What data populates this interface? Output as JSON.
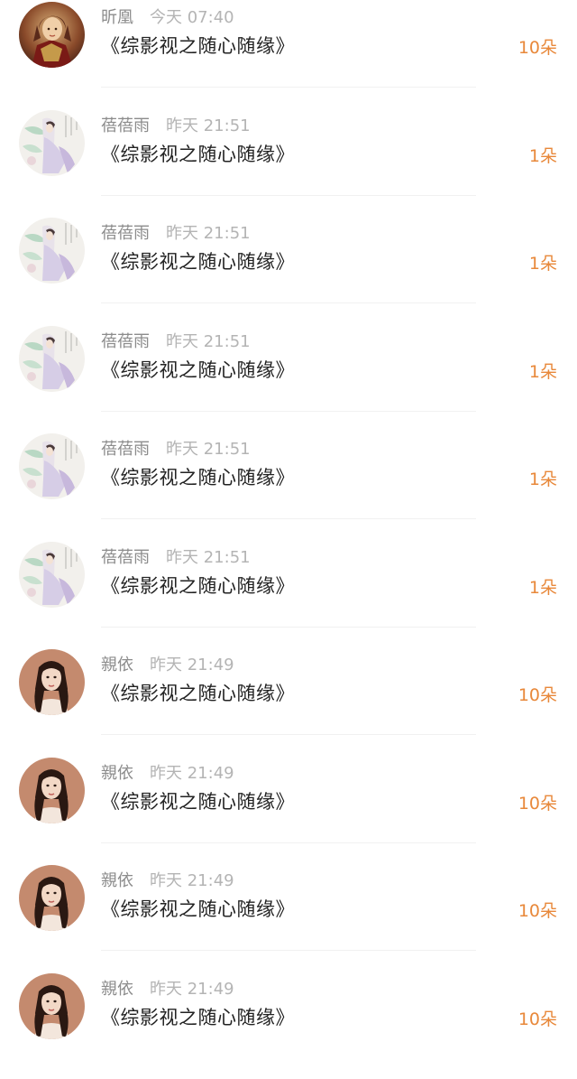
{
  "gifts": [
    {
      "name": "昕凰",
      "time": "今天 07:40",
      "book": "《综影视之随心随缘》",
      "amount": "10朵",
      "avatar": "warrior-avatar"
    },
    {
      "name": "蓓蓓雨",
      "time": "昨天 21:51",
      "book": "《综影视之随心随缘》",
      "amount": "1朵",
      "avatar": "painting-avatar"
    },
    {
      "name": "蓓蓓雨",
      "time": "昨天 21:51",
      "book": "《综影视之随心随缘》",
      "amount": "1朵",
      "avatar": "painting-avatar"
    },
    {
      "name": "蓓蓓雨",
      "time": "昨天 21:51",
      "book": "《综影视之随心随缘》",
      "amount": "1朵",
      "avatar": "painting-avatar"
    },
    {
      "name": "蓓蓓雨",
      "time": "昨天 21:51",
      "book": "《综影视之随心随缘》",
      "amount": "1朵",
      "avatar": "painting-avatar"
    },
    {
      "name": "蓓蓓雨",
      "time": "昨天 21:51",
      "book": "《综影视之随心随缘》",
      "amount": "1朵",
      "avatar": "painting-avatar"
    },
    {
      "name": "親依",
      "time": "昨天 21:49",
      "book": "《综影视之随心随缘》",
      "amount": "10朵",
      "avatar": "portrait-avatar"
    },
    {
      "name": "親依",
      "time": "昨天 21:49",
      "book": "《综影视之随心随缘》",
      "amount": "10朵",
      "avatar": "portrait-avatar"
    },
    {
      "name": "親依",
      "time": "昨天 21:49",
      "book": "《综影视之随心随缘》",
      "amount": "10朵",
      "avatar": "portrait-avatar"
    },
    {
      "name": "親依",
      "time": "昨天 21:49",
      "book": "《综影视之随心随缘》",
      "amount": "10朵",
      "avatar": "portrait-avatar"
    }
  ],
  "colors": {
    "amount": "#e8883a",
    "title": "#222222",
    "meta": "#9a9a9a"
  }
}
